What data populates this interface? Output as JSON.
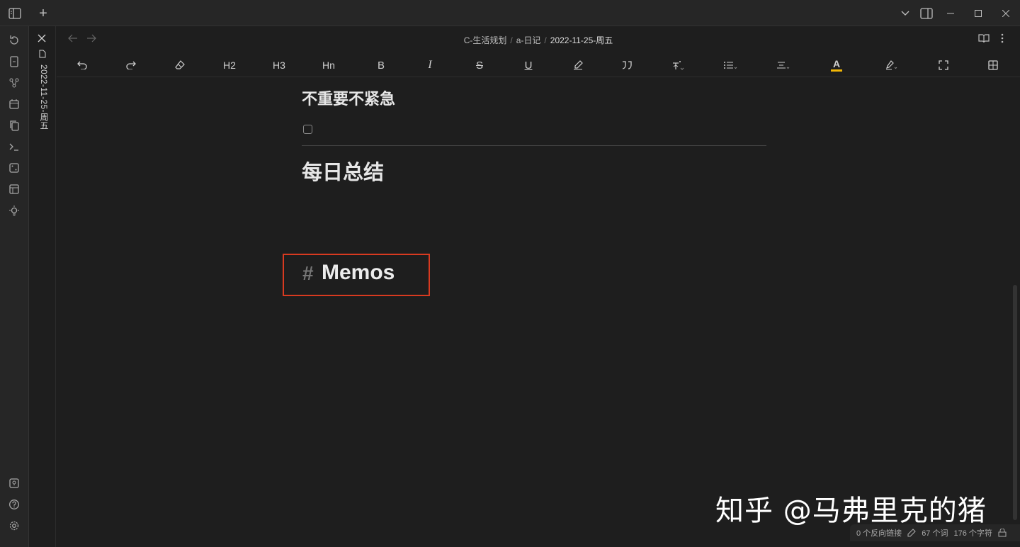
{
  "breadcrumb": [
    "C-生活规划",
    "a-日记",
    "2022-11-25-周五"
  ],
  "tab": {
    "title": "2022-11-25-周五"
  },
  "toolbar": {
    "h2": "H2",
    "h3": "H3",
    "hn": "Hn",
    "bold": "B",
    "italic": "I",
    "strike": "S",
    "underline": "U",
    "color_a": "A"
  },
  "content": {
    "heading1": "不重要不紧急",
    "heading2": "每日总结",
    "memos_hash": "#",
    "memos_title": "Memos"
  },
  "status": {
    "backlinks": "0 个反向链接",
    "words": "67 个词",
    "chars": "176 个字符"
  },
  "watermark": "知乎 @马弗里克的猪",
  "colors": {
    "accent_border": "#d83a20",
    "text_color_underline": "#f2b707"
  },
  "icons": [
    "sidebar-toggle-icon",
    "new-tab-icon",
    "chevron-down-icon",
    "right-sidebar-icon",
    "minimize-icon",
    "maximize-icon",
    "close-icon",
    "back-icon",
    "forward-icon",
    "reading-view-icon",
    "more-options-icon",
    "undo-icon",
    "redo-icon",
    "eraser-icon",
    "quote-icon",
    "list-icon",
    "align-icon",
    "highlight-icon",
    "fullscreen-icon",
    "table-icon"
  ]
}
